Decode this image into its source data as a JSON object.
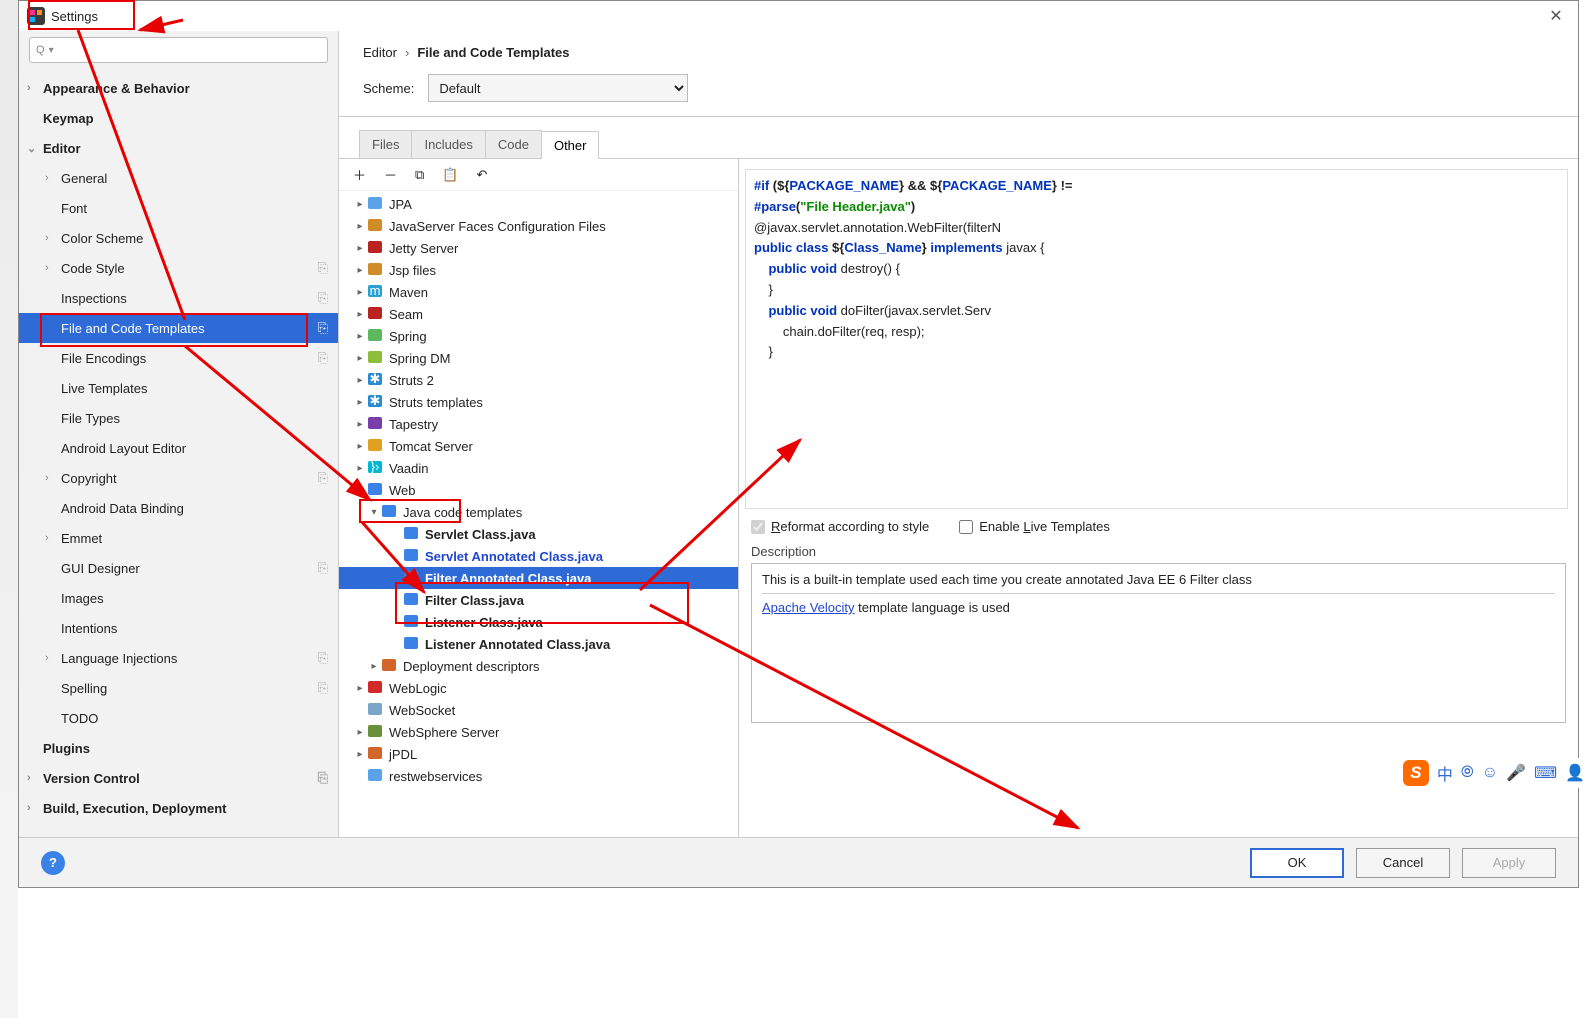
{
  "window": {
    "title": "Settings",
    "close_glyph": "✕"
  },
  "search": {
    "placeholder": "",
    "q_glyph": "Q",
    "dd_glyph": "▾"
  },
  "lefttree": [
    {
      "label": "Appearance & Behavior",
      "bold": true,
      "arrow": ">",
      "ind": 0
    },
    {
      "label": "Keymap",
      "bold": true,
      "ind": 0
    },
    {
      "label": "Editor",
      "bold": true,
      "arrow": "v",
      "ind": 0
    },
    {
      "label": "General",
      "arrow": ">",
      "ind": 1
    },
    {
      "label": "Font",
      "ind": 1
    },
    {
      "label": "Color Scheme",
      "arrow": ">",
      "ind": 1
    },
    {
      "label": "Code Style",
      "arrow": ">",
      "ind": 1,
      "cfg": true
    },
    {
      "label": "Inspections",
      "ind": 1,
      "cfg": true
    },
    {
      "label": "File and Code Templates",
      "ind": 1,
      "cfg": true,
      "sel": true
    },
    {
      "label": "File Encodings",
      "ind": 1,
      "cfg": true
    },
    {
      "label": "Live Templates",
      "ind": 1
    },
    {
      "label": "File Types",
      "ind": 1
    },
    {
      "label": "Android Layout Editor",
      "ind": 1
    },
    {
      "label": "Copyright",
      "arrow": ">",
      "ind": 1,
      "cfg": true
    },
    {
      "label": "Android Data Binding",
      "ind": 1
    },
    {
      "label": "Emmet",
      "arrow": ">",
      "ind": 1
    },
    {
      "label": "GUI Designer",
      "ind": 1,
      "cfg": true
    },
    {
      "label": "Images",
      "ind": 1
    },
    {
      "label": "Intentions",
      "ind": 1
    },
    {
      "label": "Language Injections",
      "arrow": ">",
      "ind": 1,
      "cfg": true
    },
    {
      "label": "Spelling",
      "ind": 1,
      "cfg": true
    },
    {
      "label": "TODO",
      "ind": 1
    },
    {
      "label": "Plugins",
      "bold": true,
      "ind": 0
    },
    {
      "label": "Version Control",
      "bold": true,
      "arrow": ">",
      "ind": 0,
      "cfg": true
    },
    {
      "label": "Build, Execution, Deployment",
      "bold": true,
      "arrow": ">",
      "ind": 0
    }
  ],
  "breadcrumb": {
    "a": "Editor",
    "sep": "›",
    "b": "File and Code Templates"
  },
  "scheme": {
    "label": "Scheme:",
    "value": "Default"
  },
  "tabs": [
    "Files",
    "Includes",
    "Code",
    "Other"
  ],
  "active_tab": 3,
  "toolbar_glyphs": {
    "add": "＋",
    "remove": "－",
    "copy": "⧉",
    "paste": "📋",
    "undo": "↶"
  },
  "tpltree": [
    {
      "d": 0,
      "ar": "▸",
      "ic": "#5aa3e8",
      "label": "JPA"
    },
    {
      "d": 0,
      "ar": "▸",
      "ic": "#d18c2a",
      "label": "JavaServer Faces Configuration Files"
    },
    {
      "d": 0,
      "ar": "▸",
      "ic": "#b22",
      "label": "Jetty Server"
    },
    {
      "d": 0,
      "ar": "▸",
      "ic": "#d18c2a",
      "label": "Jsp files"
    },
    {
      "d": 0,
      "ar": "▸",
      "ic": "#2aa0d1",
      "label": "Maven",
      "glyph": "m"
    },
    {
      "d": 0,
      "ar": "▸",
      "ic": "#b22",
      "label": "Seam"
    },
    {
      "d": 0,
      "ar": "▸",
      "ic": "#5cb85c",
      "label": "Spring"
    },
    {
      "d": 0,
      "ar": "▸",
      "ic": "#8bbf3a",
      "label": "Spring DM"
    },
    {
      "d": 0,
      "ar": "▸",
      "ic": "#2a8ad1",
      "label": "Struts 2",
      "glyph": "✱"
    },
    {
      "d": 0,
      "ar": "▸",
      "ic": "#2a8ad1",
      "label": "Struts templates",
      "glyph": "✱"
    },
    {
      "d": 0,
      "ar": "▸",
      "ic": "#7a3ea8",
      "label": "Tapestry"
    },
    {
      "d": 0,
      "ar": "▸",
      "ic": "#e0a020",
      "label": "Tomcat Server"
    },
    {
      "d": 0,
      "ar": "▸",
      "ic": "#00b8d4",
      "label": "Vaadin",
      "glyph": "}›"
    },
    {
      "d": 0,
      "ar": "▾",
      "ic": "#3b82e6",
      "label": "Web"
    },
    {
      "d": 1,
      "ar": "▾",
      "ic": "#3b82e6",
      "label": "Java code templates"
    },
    {
      "d": 2,
      "ic": "#3b82e6",
      "label": "Servlet Class.java",
      "bold": true
    },
    {
      "d": 2,
      "ic": "#3b82e6",
      "label": "Servlet Annotated Class.java",
      "bold": true,
      "link": true
    },
    {
      "d": 2,
      "ic": "#3b82e6",
      "label": "Filter Annotated Class.java",
      "bold": true,
      "link": true,
      "sel": true
    },
    {
      "d": 2,
      "ic": "#3b82e6",
      "label": "Filter Class.java",
      "bold": true
    },
    {
      "d": 2,
      "ic": "#3b82e6",
      "label": "Listener Class.java",
      "bold": true
    },
    {
      "d": 2,
      "ic": "#3b82e6",
      "label": "Listener Annotated Class.java",
      "bold": true
    },
    {
      "d": 1,
      "ar": "▸",
      "ic": "#d1652a",
      "label": "Deployment descriptors"
    },
    {
      "d": 0,
      "ar": "▸",
      "ic": "#d12a2a",
      "label": "WebLogic"
    },
    {
      "d": 0,
      "ar": "",
      "ic": "#7aa7c7",
      "label": "WebSocket"
    },
    {
      "d": 0,
      "ar": "▸",
      "ic": "#6a8f3a",
      "label": "WebSphere Server"
    },
    {
      "d": 0,
      "ar": "▸",
      "ic": "#d1652a",
      "label": "jPDL"
    },
    {
      "d": 0,
      "ar": "",
      "ic": "#5aa3e8",
      "label": "restwebservices"
    }
  ],
  "code_lines": [
    [
      {
        "t": "#if ",
        "c": "tok-kw"
      },
      {
        "t": "(${",
        "c": "tok-bold"
      },
      {
        "t": "PACKAGE_NAME",
        "c": "tok-var"
      },
      {
        "t": "} && ${",
        "c": "tok-bold"
      },
      {
        "t": "PACKAGE_NAME",
        "c": "tok-var"
      },
      {
        "t": "} !=",
        "c": "tok-bold"
      }
    ],
    [
      {
        "t": "#parse",
        "c": "tok-kw"
      },
      {
        "t": "(",
        "c": "tok-bold"
      },
      {
        "t": "\"File Header.java\"",
        "c": "tok-str"
      },
      {
        "t": ")",
        "c": "tok-bold"
      }
    ],
    [
      {
        "t": "@javax.servlet.annotation.WebFilter(filterN",
        "c": ""
      }
    ],
    [
      {
        "t": "public class ",
        "c": "tok-kw"
      },
      {
        "t": "${",
        "c": "tok-bold"
      },
      {
        "t": "Class_Name",
        "c": "tok-var"
      },
      {
        "t": "}",
        "c": "tok-bold"
      },
      {
        "t": " implements ",
        "c": "tok-kw"
      },
      {
        "t": "javax",
        "c": ""
      },
      {
        "t": " {",
        "c": ""
      }
    ],
    [
      {
        "t": "    public void ",
        "c": "tok-kw"
      },
      {
        "t": "destroy() {",
        "c": ""
      }
    ],
    [
      {
        "t": "    }",
        "c": ""
      }
    ],
    [
      {
        "t": "",
        "c": ""
      }
    ],
    [
      {
        "t": "    public void ",
        "c": "tok-kw"
      },
      {
        "t": "doFilter(javax.servlet.Serv",
        "c": ""
      }
    ],
    [
      {
        "t": "        chain.doFilter(req, resp);",
        "c": ""
      }
    ],
    [
      {
        "t": "    }",
        "c": ""
      }
    ]
  ],
  "opts": {
    "reformat": "Reformat according to style",
    "enable": "Enable Live Templates",
    "r_hot": "R",
    "l_hot": "L"
  },
  "desc": {
    "label": "Description",
    "line1": "This is a built-in template used each time you create annotated Java EE 6 Filter class",
    "link": "Apache Velocity",
    "line2": " template language is used"
  },
  "buttons": {
    "ok": "OK",
    "cancel": "Cancel",
    "apply": "Apply"
  },
  "ime": {
    "s": "S",
    "items": [
      "中",
      "⦾",
      "☺",
      "🎤",
      "⌨",
      "👤"
    ]
  }
}
